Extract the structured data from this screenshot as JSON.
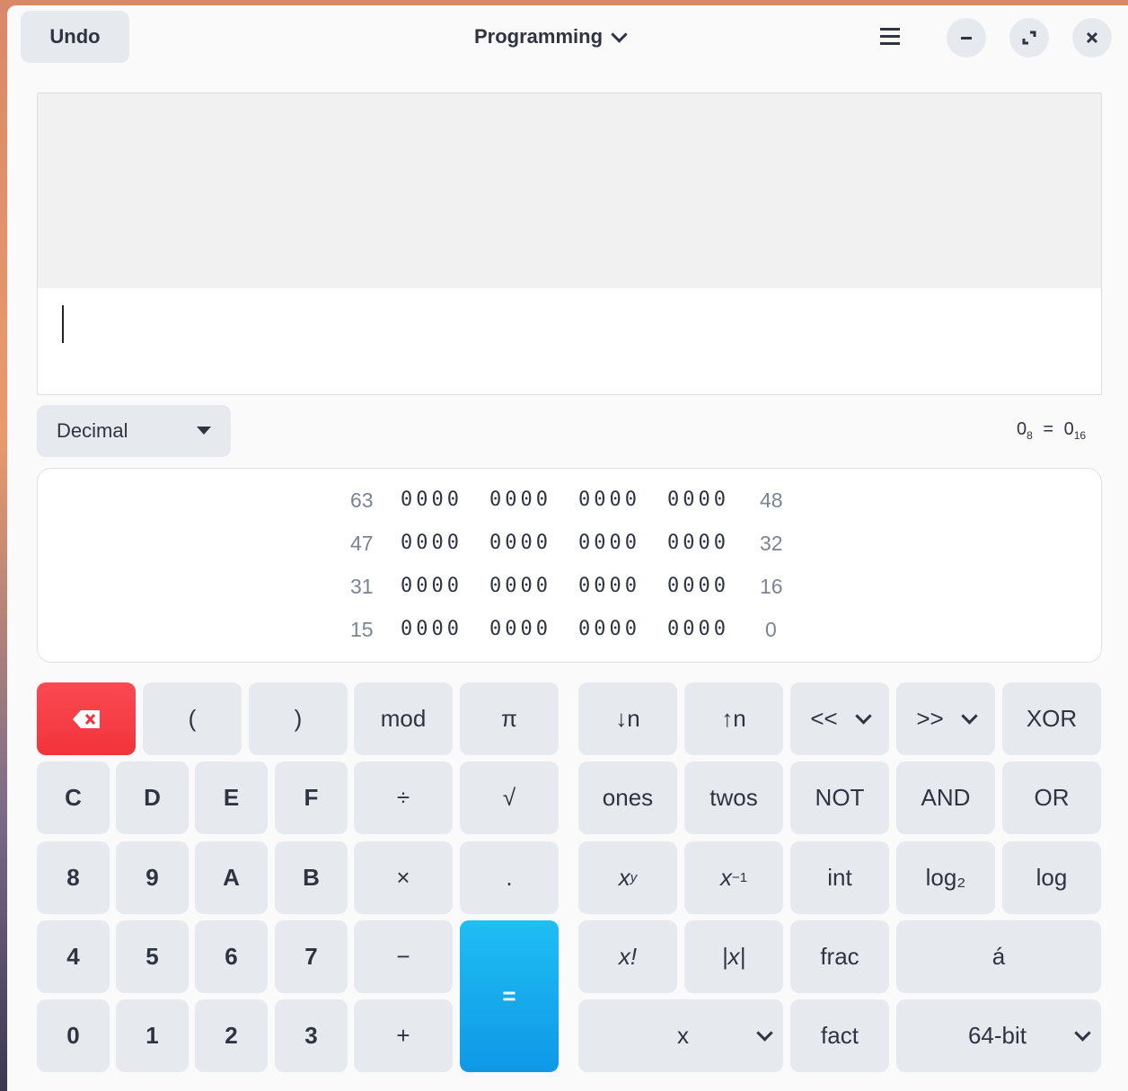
{
  "header": {
    "undo_label": "Undo",
    "mode_label": "Programming"
  },
  "display": {
    "history": "",
    "input": ""
  },
  "base_select": {
    "value": "Decimal"
  },
  "conversion": {
    "oct": "0",
    "oct_sub": "8",
    "eq": "=",
    "hex": "0",
    "hex_sub": "16"
  },
  "bit_rows": [
    {
      "hi": "63",
      "groups": [
        "0000",
        "0000",
        "0000",
        "0000"
      ],
      "lo": "48"
    },
    {
      "hi": "47",
      "groups": [
        "0000",
        "0000",
        "0000",
        "0000"
      ],
      "lo": "32"
    },
    {
      "hi": "31",
      "groups": [
        "0000",
        "0000",
        "0000",
        "0000"
      ],
      "lo": "16"
    },
    {
      "hi": "15",
      "groups": [
        "0000",
        "0000",
        "0000",
        "0000"
      ],
      "lo": "0"
    }
  ],
  "keys": {
    "lparen": "(",
    "rparen": ")",
    "mod": "mod",
    "pi": "π",
    "C": "C",
    "D": "D",
    "E": "E",
    "F": "F",
    "div": "÷",
    "sqrt": "√",
    "k8": "8",
    "k9": "9",
    "A": "A",
    "B": "B",
    "mul": "×",
    "dot": ".",
    "k4": "4",
    "k5": "5",
    "k6": "6",
    "k7": "7",
    "minus": "−",
    "equals": "=",
    "k0": "0",
    "k1": "1",
    "k2": "2",
    "k3": "3",
    "plus": "+"
  },
  "func_keys": {
    "down_n": "↓n",
    "up_n": "↑n",
    "shl": "<<",
    "shr": ">>",
    "xor": "XOR",
    "ones": "ones",
    "twos": "twos",
    "not": "NOT",
    "and": "AND",
    "or": "OR",
    "x_base": "x",
    "y_sup": "y",
    "inv_sup": "−1",
    "int": "int",
    "log2_base": "log",
    "log2_sub": "₂",
    "log": "log",
    "fact_sym": "x!",
    "abs": "|x|",
    "frac": "frac",
    "char": "á",
    "var_x": "x",
    "fact": "fact",
    "word_size": "64-bit"
  },
  "colors": {
    "backspace": "#f5323a",
    "equals": "#1aa7ec",
    "key": "#e6e9ee"
  }
}
